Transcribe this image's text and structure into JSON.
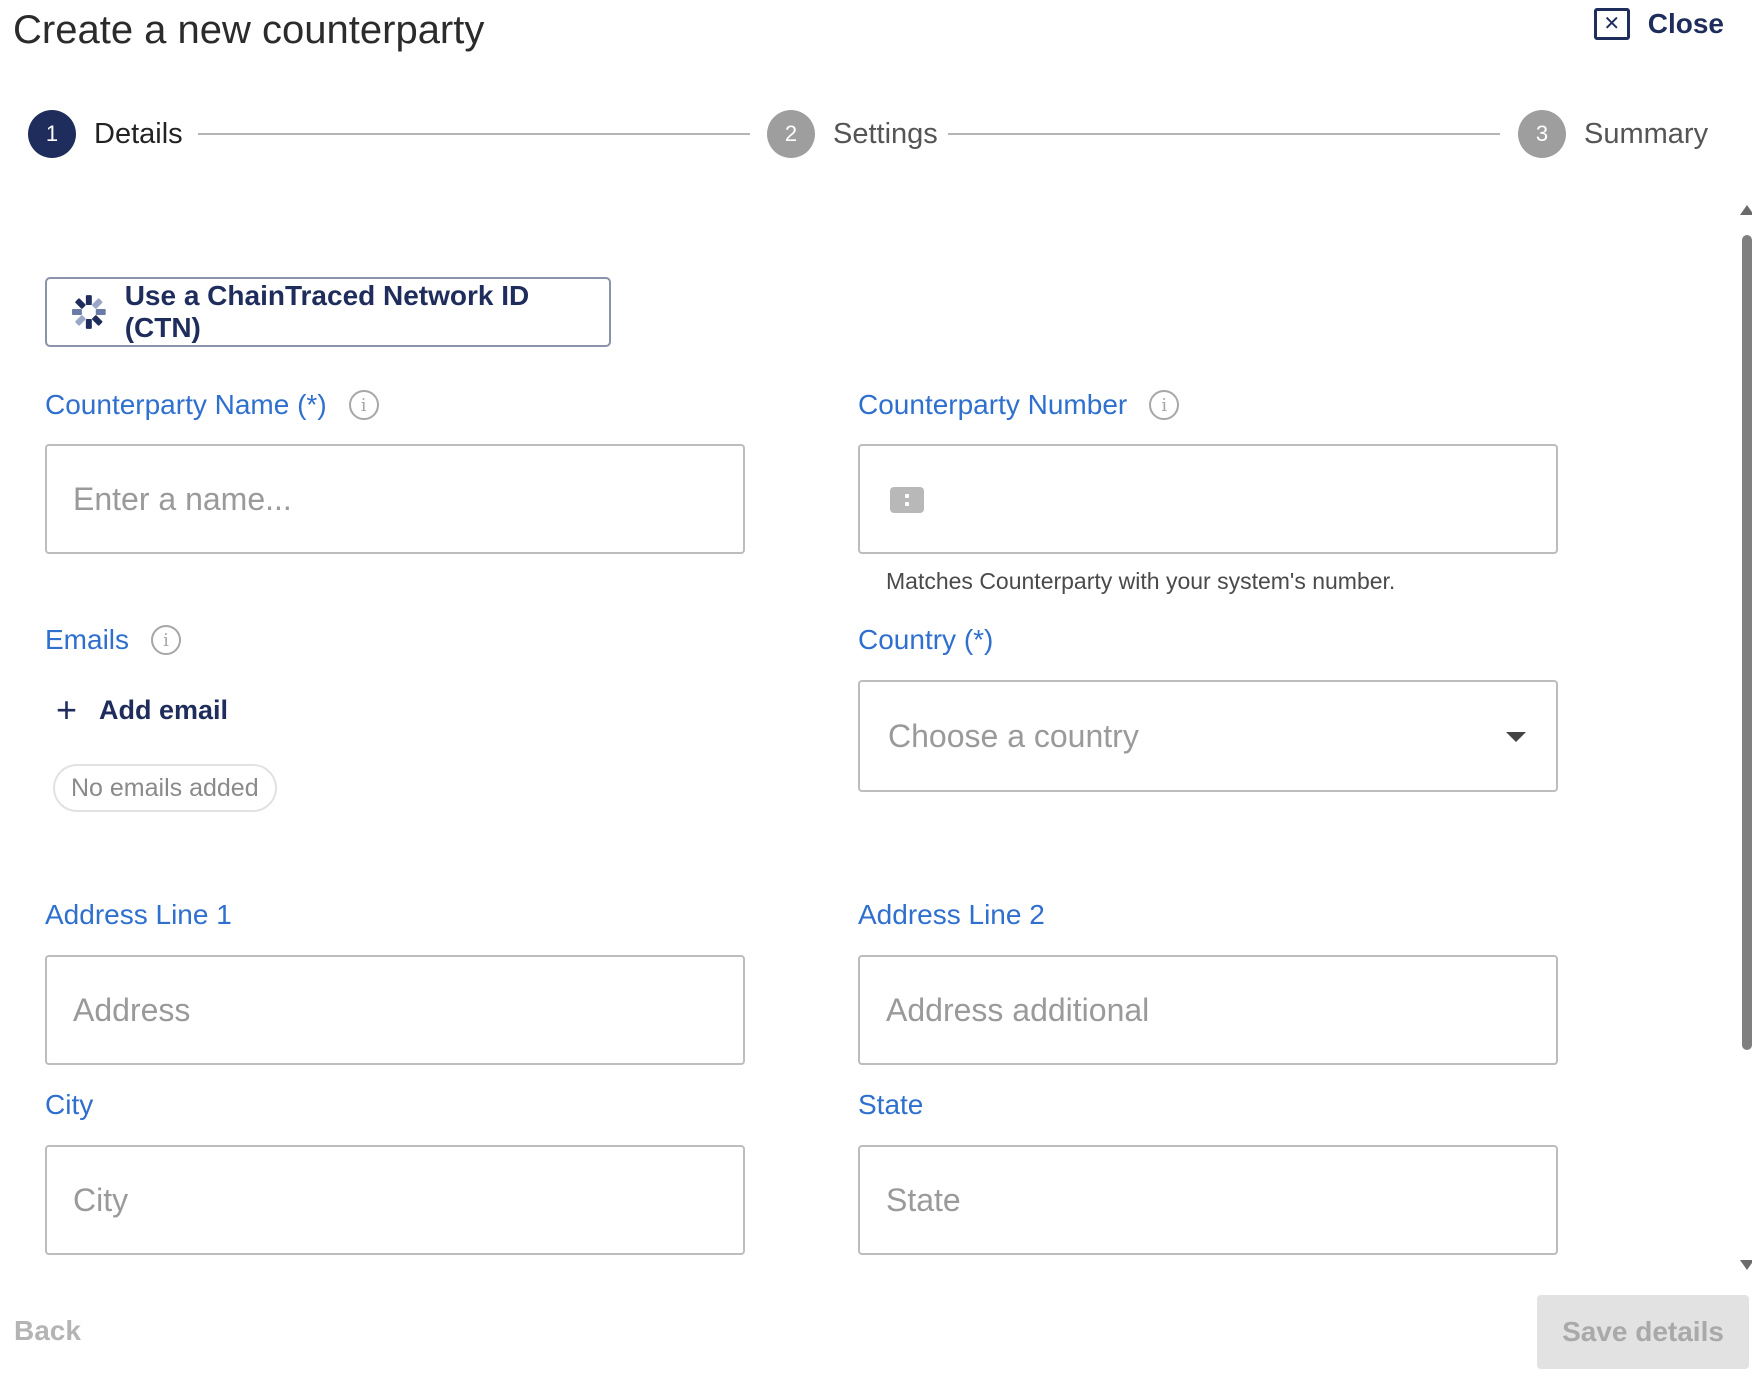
{
  "header": {
    "title": "Create a new counterparty",
    "close_label": "Close",
    "close_icon": "close-box-icon"
  },
  "stepper": {
    "steps": [
      {
        "number": "1",
        "label": "Details",
        "state": "active"
      },
      {
        "number": "2",
        "label": "Settings",
        "state": "inactive"
      },
      {
        "number": "3",
        "label": "Summary",
        "state": "inactive"
      }
    ]
  },
  "ctn_button": {
    "label": "Use a ChainTraced Network ID (CTN)",
    "icon": "ctn-logo-icon"
  },
  "form": {
    "name": {
      "label": "Counterparty Name (*)",
      "placeholder": "Enter a name...",
      "value": ""
    },
    "number": {
      "label": "Counterparty Number",
      "value": "",
      "helper": "Matches Counterparty with your system's number."
    },
    "emails": {
      "label": "Emails",
      "add_label": "Add email",
      "empty_label": "No emails added"
    },
    "country": {
      "label": "Country (*)",
      "placeholder": "Choose a country"
    },
    "address1": {
      "label": "Address Line 1",
      "placeholder": "Address",
      "value": ""
    },
    "address2": {
      "label": "Address Line 2",
      "placeholder": "Address additional",
      "value": ""
    },
    "city": {
      "label": "City",
      "placeholder": "City",
      "value": ""
    },
    "state": {
      "label": "State",
      "placeholder": "State",
      "value": ""
    }
  },
  "footer": {
    "back_label": "Back",
    "save_label": "Save details"
  },
  "colors": {
    "brand_navy": "#1f2d5c",
    "label_blue": "#2f6fce",
    "inactive_gray": "#9e9e9e",
    "disabled_bg": "#e2e2e2"
  }
}
